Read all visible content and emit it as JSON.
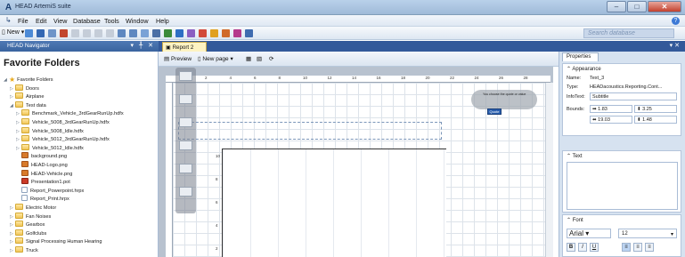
{
  "window": {
    "title": "HEAD ArtemiS suite",
    "app_icon": "A"
  },
  "menu": [
    "File",
    "Edit",
    "View",
    "Database",
    "Tools",
    "Window",
    "Help"
  ],
  "toolbar": {
    "new_label": "New",
    "search_placeholder": "Search database"
  },
  "navigator": {
    "header": "HEAD Navigator",
    "title": "Favorite Folders",
    "items": [
      {
        "label": "Favorite Folders",
        "level": 0,
        "icon": "star"
      },
      {
        "label": "Doors",
        "level": 1,
        "icon": "folder"
      },
      {
        "label": "Airplane",
        "level": 1,
        "icon": "folder"
      },
      {
        "label": "Test data",
        "level": 1,
        "icon": "folder"
      },
      {
        "label": "Benchmark_Vehicle_3rdGearRunUp.hdfx",
        "level": 2,
        "icon": "folder"
      },
      {
        "label": "Vehicle_5008_3rdGearRunUp.hdfx",
        "level": 2,
        "icon": "folder"
      },
      {
        "label": "Vehicle_5008_Idle.hdfx",
        "level": 2,
        "icon": "folder"
      },
      {
        "label": "Vehicle_5012_3rdGearRunUp.hdfx",
        "level": 2,
        "icon": "folder"
      },
      {
        "label": "Vehicle_5012_Idle.hdfx",
        "level": 2,
        "icon": "folder"
      },
      {
        "label": "background.png",
        "level": 2,
        "icon": "image"
      },
      {
        "label": "HEAD-Logo.png",
        "level": 2,
        "icon": "image"
      },
      {
        "label": "HEAD-Vehicle.png",
        "level": 2,
        "icon": "image"
      },
      {
        "label": "Presentation1.pot",
        "level": 2,
        "icon": "ppt"
      },
      {
        "label": "Report_Powerpoint.hrpx",
        "level": 2,
        "icon": "file"
      },
      {
        "label": "Report_Print.hrpx",
        "level": 2,
        "icon": "file"
      },
      {
        "label": "Electric Motor",
        "level": 1,
        "icon": "folder"
      },
      {
        "label": "Fan Noises",
        "level": 1,
        "icon": "folder"
      },
      {
        "label": "Gearbox",
        "level": 1,
        "icon": "folder"
      },
      {
        "label": "Golfclubs",
        "level": 1,
        "icon": "folder"
      },
      {
        "label": "Signal Processing Human Hearing",
        "level": 1,
        "icon": "folder"
      },
      {
        "label": "Truck",
        "level": 1,
        "icon": "folder"
      }
    ]
  },
  "document": {
    "tab_label": "Report 2",
    "toolbar": {
      "preview": "Preview",
      "new_page": "New page"
    },
    "ruler_top": [
      "2",
      "4",
      "6",
      "8",
      "10",
      "12",
      "14",
      "16",
      "18",
      "20",
      "22",
      "24",
      "26",
      "28"
    ],
    "ruler_left": [
      "10",
      "8",
      "6",
      "4",
      "2"
    ],
    "hud_text": "You choose the quote or value",
    "hud_badge": "Quote"
  },
  "properties": {
    "tab": "Properties",
    "appearance": {
      "header": "Appearance",
      "name_label": "Name:",
      "name_value": "Text_3",
      "type_label": "Type:",
      "type_value": "HEADacoustics.Reporting.Cont...",
      "infotext_label": "InfoText:",
      "infotext_value": "Subtitle",
      "bounds_label": "Bounds:",
      "x": "1.83",
      "y": "3.25",
      "w": "19.03",
      "h": "1.48"
    },
    "text": {
      "header": "Text"
    },
    "font": {
      "header": "Font",
      "family": "Arial",
      "size": "12"
    }
  }
}
